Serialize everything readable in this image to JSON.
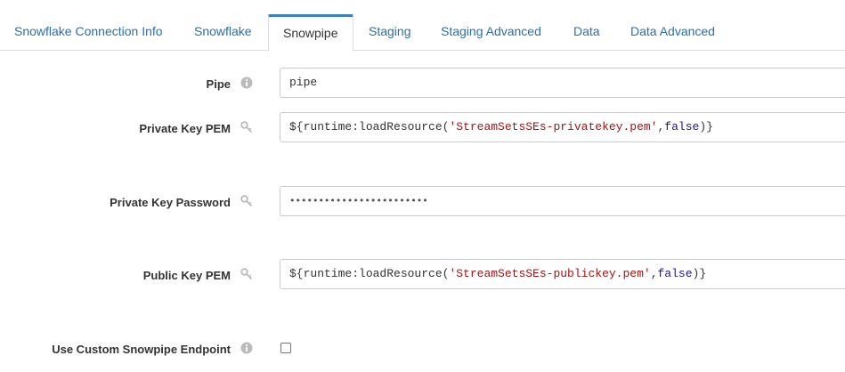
{
  "tabs": [
    {
      "label": "Snowflake Connection Info",
      "active": false
    },
    {
      "label": "Snowflake",
      "active": false
    },
    {
      "label": "Snowpipe",
      "active": true
    },
    {
      "label": "Staging",
      "active": false
    },
    {
      "label": "Staging Advanced",
      "active": false
    },
    {
      "label": "Data",
      "active": false
    },
    {
      "label": "Data Advanced",
      "active": false
    }
  ],
  "form": {
    "pipe": {
      "label": "Pipe",
      "icon": "info-icon",
      "value": "pipe"
    },
    "private_key_pem": {
      "label": "Private Key PEM",
      "icon": "key-icon",
      "prefix": "${runtime:loadResource(",
      "str": "'StreamSetsSEs-privatekey.pem'",
      "sep": ",",
      "kw": "false",
      "suffix": ")}"
    },
    "private_key_password": {
      "label": "Private Key Password",
      "icon": "key-icon",
      "value": "••••••••••••••••••••••••"
    },
    "public_key_pem": {
      "label": "Public Key PEM",
      "icon": "key-icon",
      "prefix": "${runtime:loadResource(",
      "str": "'StreamSetsSEs-publickey.pem'",
      "sep": ",",
      "kw": "false",
      "suffix": ")}"
    },
    "custom_endpoint": {
      "label": "Use Custom Snowpipe Endpoint",
      "icon": "info-icon",
      "checked": false
    }
  },
  "colors": {
    "link": "#2a6fb0",
    "active_tab_border": "#3a7fc4",
    "string_token": "#aa1111",
    "keyword_token": "#221199"
  }
}
